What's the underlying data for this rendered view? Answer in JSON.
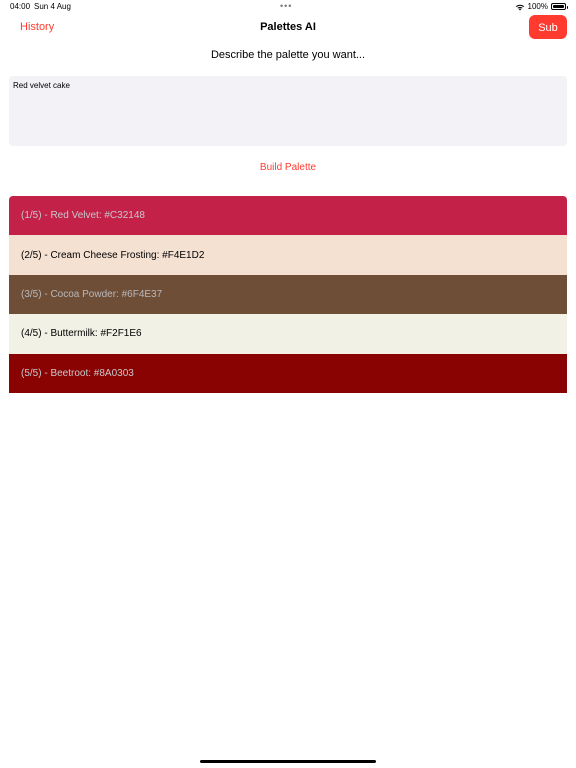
{
  "status_bar": {
    "time": "04:00",
    "date": "Sun 4 Aug",
    "dots": "•••",
    "battery": "100%"
  },
  "nav": {
    "history_label": "History",
    "title": "Palettes AI",
    "sub_label": "Sub"
  },
  "prompt": {
    "label": "Describe the palette you want...",
    "value": "Red velvet cake"
  },
  "build_label": "Build Palette",
  "palette": [
    {
      "text": "(1/5) -  Red Velvet: #C32148",
      "bg": "#C32148",
      "fg": "#c8c8cc"
    },
    {
      "text": "(2/5) -  Cream Cheese Frosting: #F4E1D2",
      "bg": "#F4E1D2",
      "fg": "#000000"
    },
    {
      "text": "(3/5) -  Cocoa Powder: #6F4E37",
      "bg": "#6F4E37",
      "fg": "#b8b8bc"
    },
    {
      "text": "(4/5) -  Buttermilk: #F2F1E6",
      "bg": "#F2F1E6",
      "fg": "#000000"
    },
    {
      "text": "(5/5) -  Beetroot: #8A0303",
      "bg": "#8A0303",
      "fg": "#c8c8cc"
    }
  ],
  "colors": {
    "accent": "#ff3b30",
    "input_bg": "#f2f2f7"
  }
}
